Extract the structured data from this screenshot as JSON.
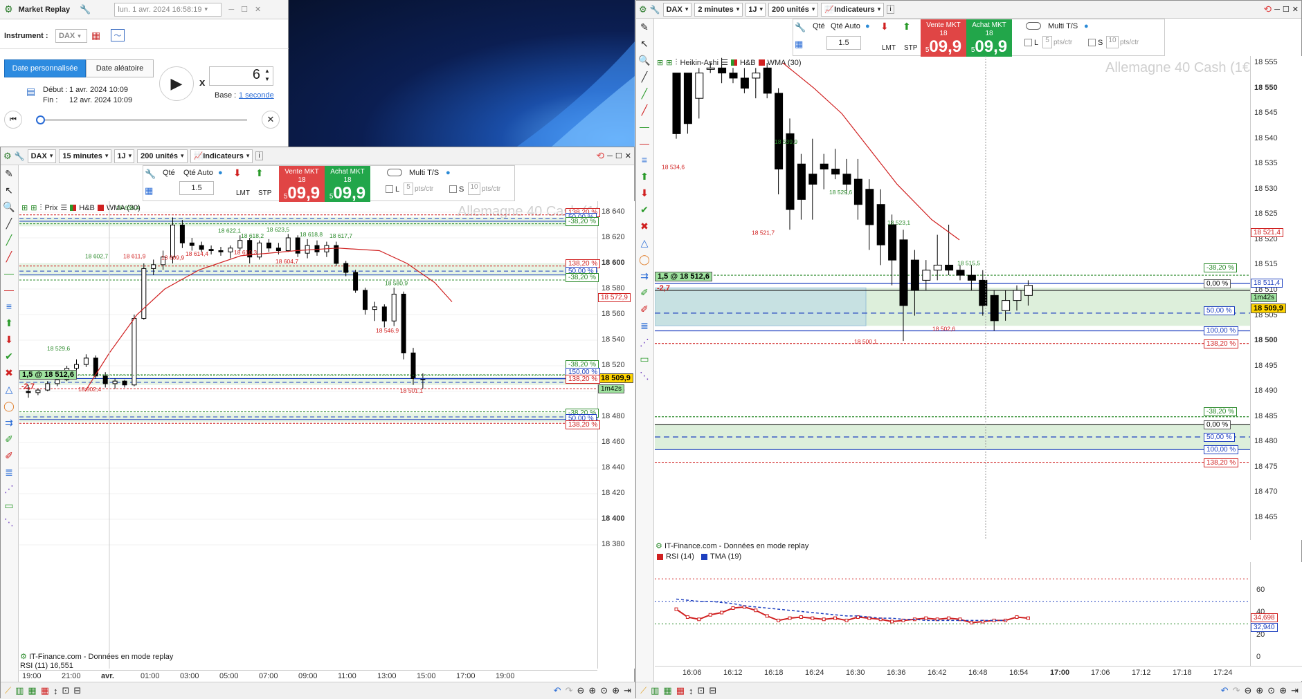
{
  "replay": {
    "title": "Market Replay",
    "date_field": "lun. 1 avr. 2024 16:58:19",
    "instrument_label": "Instrument :",
    "instrument": "DAX",
    "tab_custom": "Date personnalisée",
    "tab_random": "Date aléatoire",
    "start_label": "Début :",
    "start_value": "1 avr. 2024 10:09",
    "end_label": "Fin :",
    "end_value": "12 avr. 2024 10:09",
    "speed_x": "x",
    "speed": "6",
    "base_label": "Base :",
    "base_value": "1 seconde"
  },
  "left_chart": {
    "instrument": "DAX",
    "timeframe": "15 minutes",
    "period": "1J",
    "units": "200 unités",
    "indicators": "Indicateurs",
    "qty_label": "Qté",
    "qty_auto": "Qté Auto",
    "qty_value": "1.5",
    "lmt": "LMT",
    "stp": "STP",
    "sell_label": "Vente MKT",
    "sell_small": "18 5",
    "sell_big": "09,9",
    "buy_label": "Achat MKT",
    "buy_small": "18 5",
    "buy_big": "09,9",
    "multi_ts": "Multi T/S",
    "l_label": "L",
    "l_value": "5",
    "s_label": "S",
    "s_value": "10",
    "pts": "pts/ctr",
    "legend_prix": "Prix",
    "legend_hb": "H&B",
    "legend_wma": "WMA (30)",
    "watermark": "Allemagne 40 Cash (1€)",
    "position": "1,5 @ 18 512,6",
    "pnl": "-2,7",
    "current_price": "18 509,9",
    "countdown": "1m42s",
    "red_price": "18 572,9",
    "footer": "IT-Finance.com - Données en mode replay",
    "rsi_label": "RSI (11) 16,551",
    "y_ticks": [
      "18 640",
      "18 620",
      "18 600",
      "18 580",
      "18 560",
      "18 540",
      "18 520",
      "18 500",
      "18 480",
      "18 460",
      "18 440",
      "18 420",
      "18 400",
      "18 380"
    ],
    "x_ticks": [
      "19:00",
      "21:00",
      "avr.",
      "01:00",
      "03:00",
      "05:00",
      "07:00",
      "09:00",
      "11:00",
      "13:00",
      "15:00",
      "17:00",
      "19:00"
    ],
    "candle_labels": [
      "18 636,4",
      "18 622,1",
      "18 618,2",
      "18 623,5",
      "18 618,8",
      "18 617,7",
      "18 602,7",
      "18 611,9",
      "18 609,9",
      "18 614,4",
      "18 610,3",
      "18 604,7",
      "18 580,9",
      "18 546,9",
      "18 529,6",
      "18 502,4",
      "18 501,1"
    ],
    "fib_tags": [
      "138,20 %",
      "50,00 %",
      "-38,20 %",
      "138,20 %",
      "50,00 %",
      "-38,20 %",
      "-38,20 %",
      "150,00 %",
      "138,20 %",
      "-38,20 %",
      "50,00 %",
      "138,20 %"
    ]
  },
  "right_chart": {
    "instrument": "DAX",
    "timeframe": "2 minutes",
    "period": "1J",
    "units": "200 unités",
    "indicators": "Indicateurs",
    "qty_label": "Qté",
    "qty_auto": "Qté Auto",
    "qty_value": "1.5",
    "lmt": "LMT",
    "stp": "STP",
    "sell_label": "Vente MKT",
    "sell_small": "18 5",
    "sell_big": "09,9",
    "buy_label": "Achat MKT",
    "buy_small": "18 5",
    "buy_big": "09,9",
    "multi_ts": "Multi T/S",
    "l_label": "L",
    "l_value": "5",
    "s_label": "S",
    "s_value": "10",
    "pts": "pts/ctr",
    "legend_ha": "Heikin-Ashi",
    "legend_hb": "H&B",
    "legend_wma": "WMA (30)",
    "watermark": "Allemagne 40 Cash (1€)",
    "position": "1,5 @ 18 512,6",
    "pnl": "-2,7",
    "current_price": "18 509,9",
    "countdown": "1m42s",
    "red_price": "18 521,4",
    "ask_price": "18 511,4",
    "footer": "IT-Finance.com - Données en mode replay",
    "rsi_legend": "RSI (14)",
    "tma_legend": "TMA (19)",
    "rsi_value": "34,698",
    "tma_value": "32,940",
    "y_ticks": [
      "18 555",
      "18 550",
      "18 545",
      "18 540",
      "18 535",
      "18 530",
      "18 525",
      "18 520",
      "18 515",
      "18 510",
      "18 505",
      "18 500",
      "18 495",
      "18 490",
      "18 485",
      "18 480",
      "18 475",
      "18 470",
      "18 465"
    ],
    "rsi_ticks": [
      "60",
      "40",
      "20",
      "0"
    ],
    "x_ticks": [
      "16:06",
      "16:12",
      "16:18",
      "16:24",
      "16:30",
      "16:36",
      "16:42",
      "16:48",
      "16:54",
      "17:00",
      "17:06",
      "17:12",
      "17:18",
      "17:24"
    ],
    "candle_labels": [
      "18 534,6",
      "18 539,9",
      "18 521,7",
      "18 529,6",
      "18 523,1",
      "18 515,5",
      "18 502,6",
      "18 500,1"
    ],
    "fib_tags": [
      "-38,20 %",
      "0,00 %",
      "50,00 %",
      "100,00 %",
      "138,20 %",
      "-38,20 %",
      "0,00 %",
      "50,00 %",
      "100,00 %",
      "138,20 %"
    ]
  }
}
